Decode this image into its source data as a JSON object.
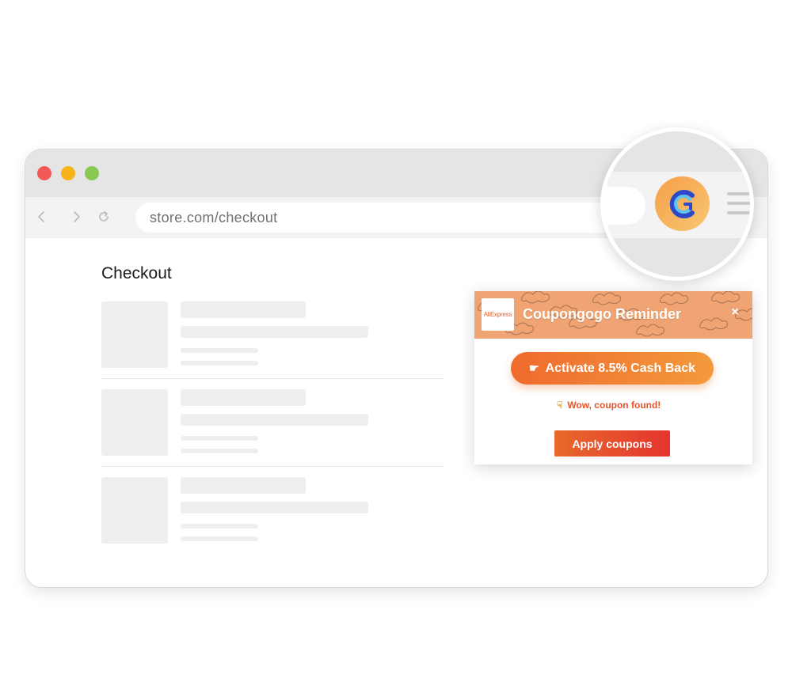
{
  "browser": {
    "window_controls": [
      "close",
      "minimize",
      "maximize"
    ],
    "nav": {
      "back_icon": "arrow-left-icon",
      "forward_icon": "arrow-right-icon",
      "reload_icon": "reload-icon"
    },
    "address": "store.com/checkout"
  },
  "page": {
    "title": "Checkout",
    "items_count_shown": 3
  },
  "extension": {
    "icon": "coupongogo-logo-icon",
    "menu_icon": "hamburger-menu-icon"
  },
  "popup": {
    "store_logo_text": "AliExpress",
    "title": "Coupongogo Reminder",
    "close_label": "×",
    "cashback_button": "Activate 8.5% Cash Back",
    "cashback_icon": "pointing-hand-icon",
    "status_icon": "pointing-down-hand-icon",
    "status_text": "Wow, coupon found!",
    "apply_button": "Apply coupons"
  },
  "colors": {
    "accent_orange": "#ef6a2e",
    "apply_red": "#e4342f",
    "status_text": "#e5542a"
  }
}
